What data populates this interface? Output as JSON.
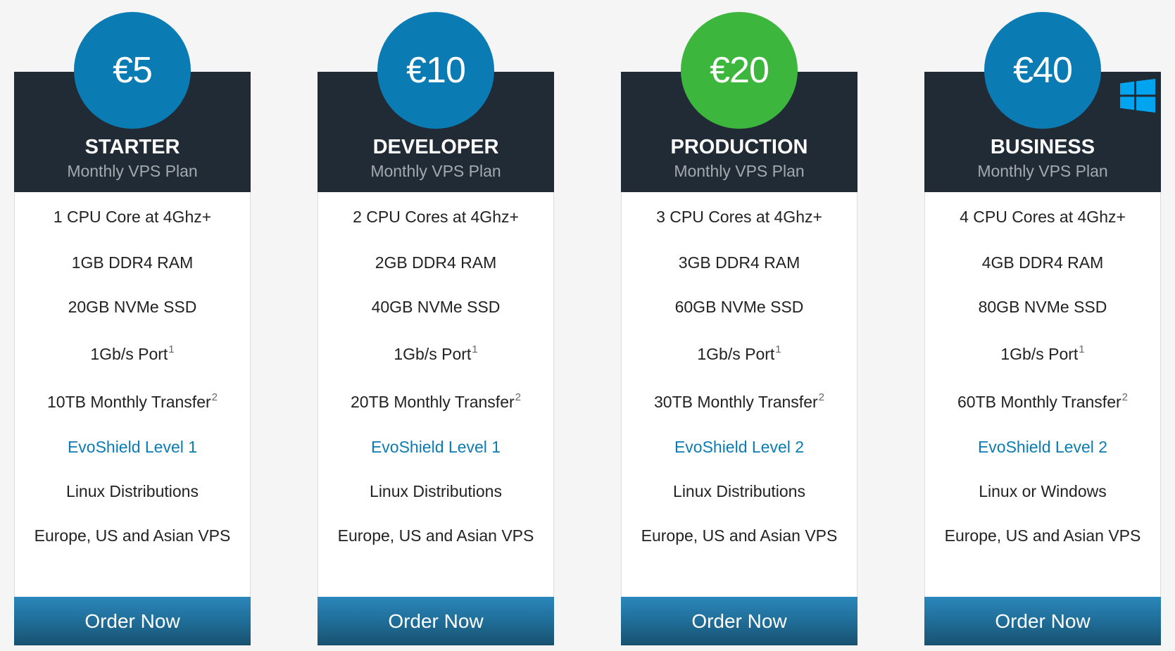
{
  "plans": [
    {
      "price": "€5",
      "name": "STARTER",
      "subtitle": "Monthly VPS Plan",
      "circle_color": "#0b7bb4",
      "cpu": "1 CPU Core at 4Ghz+",
      "ram": "1GB DDR4 RAM",
      "ssd": "20GB NVMe SSD",
      "port": "1Gb/s Port",
      "port_note": "1",
      "transfer": "10TB Monthly Transfer",
      "transfer_note": "2",
      "shield": "EvoShield Level 1",
      "os": "Linux Distributions",
      "locations": "Europe, US and Asian VPS",
      "order_label": "Order Now"
    },
    {
      "price": "€10",
      "name": "DEVELOPER",
      "subtitle": "Monthly VPS Plan",
      "circle_color": "#0b7bb4",
      "cpu": "2 CPU Cores at 4Ghz+",
      "ram": "2GB DDR4 RAM",
      "ssd": "40GB NVMe SSD",
      "port": "1Gb/s Port",
      "port_note": "1",
      "transfer": "20TB Monthly Transfer",
      "transfer_note": "2",
      "shield": "EvoShield Level 1",
      "os": "Linux Distributions",
      "locations": "Europe, US and Asian VPS",
      "order_label": "Order Now"
    },
    {
      "price": "€20",
      "name": "PRODUCTION",
      "subtitle": "Monthly VPS Plan",
      "circle_color": "#3cb63c",
      "cpu": "3 CPU Cores at 4Ghz+",
      "ram": "3GB DDR4 RAM",
      "ssd": "60GB NVMe SSD",
      "port": "1Gb/s Port",
      "port_note": "1",
      "transfer": "30TB Monthly Transfer",
      "transfer_note": "2",
      "shield": "EvoShield Level 2",
      "os": "Linux Distributions",
      "locations": "Europe, US and Asian VPS",
      "order_label": "Order Now"
    },
    {
      "price": "€40",
      "name": "BUSINESS",
      "subtitle": "Monthly VPS Plan",
      "circle_color": "#0b7bb4",
      "badge_icon": "windows-logo-icon",
      "cpu": "4 CPU Cores at 4Ghz+",
      "ram": "4GB DDR4 RAM",
      "ssd": "80GB NVMe SSD",
      "port": "1Gb/s Port",
      "port_note": "1",
      "transfer": "60TB Monthly Transfer",
      "transfer_note": "2",
      "shield": "EvoShield Level 2",
      "os": "Linux or Windows",
      "locations": "Europe, US and Asian VPS",
      "order_label": "Order Now"
    }
  ],
  "colors": {
    "page_background": "#f5f5f5",
    "header_background": "#212b35",
    "accent_blue": "#0b7bb4",
    "accent_green": "#3cb63c"
  }
}
